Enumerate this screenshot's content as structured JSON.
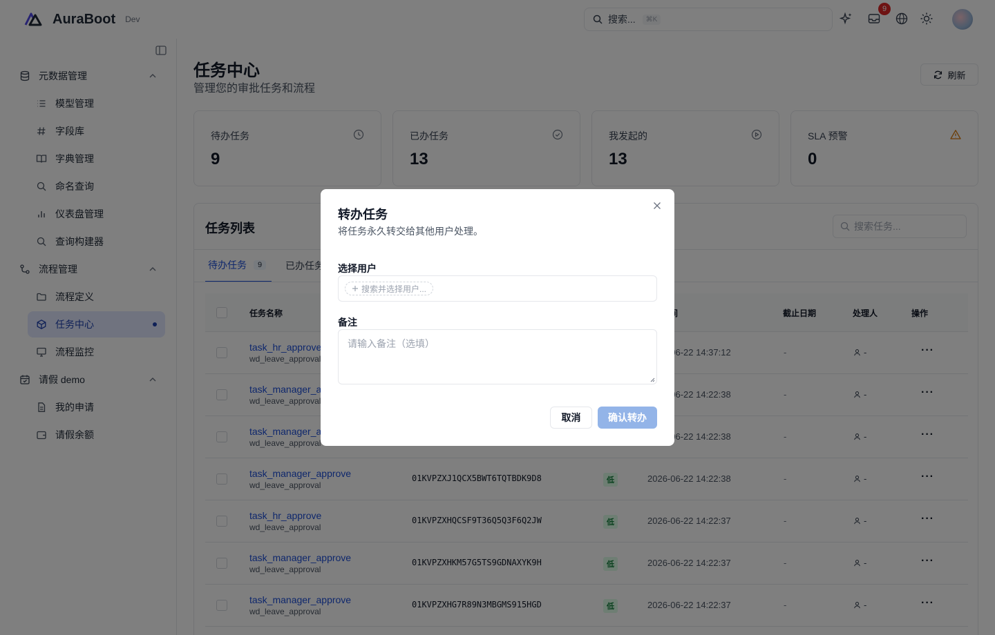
{
  "header": {
    "brand": "AuraBoot",
    "env": "Dev",
    "search_placeholder": "搜索...",
    "search_shortcut": "⌘K",
    "notification_count": "9"
  },
  "sidebar": {
    "groups": [
      {
        "label": "元数据管理",
        "items": [
          {
            "label": "模型管理"
          },
          {
            "label": "字段库"
          },
          {
            "label": "字典管理"
          },
          {
            "label": "命名查询"
          },
          {
            "label": "仪表盘管理"
          },
          {
            "label": "查询构建器"
          }
        ]
      },
      {
        "label": "流程管理",
        "items": [
          {
            "label": "流程定义"
          },
          {
            "label": "任务中心"
          },
          {
            "label": "流程监控"
          }
        ]
      },
      {
        "label": "请假 demo",
        "items": [
          {
            "label": "我的申请"
          },
          {
            "label": "请假余额"
          }
        ]
      }
    ]
  },
  "page": {
    "title": "任务中心",
    "subtitle": "管理您的审批任务和流程",
    "refresh_label": "刷新"
  },
  "stats": [
    {
      "label": "待办任务",
      "value": "9"
    },
    {
      "label": "已办任务",
      "value": "13"
    },
    {
      "label": "我发起的",
      "value": "13"
    },
    {
      "label": "SLA 预警",
      "value": "0"
    }
  ],
  "task_list": {
    "title": "任务列表",
    "search_placeholder": "搜索任务...",
    "tabs": [
      {
        "label": "待办任务",
        "count": "9"
      },
      {
        "label": "已办任务"
      }
    ],
    "columns": {
      "name": "任务名称",
      "time_suffix": "间",
      "due": "截止日期",
      "assignee": "处理人",
      "actions": "操作"
    },
    "rows": [
      {
        "name": "task_hr_approve",
        "sub": "wd_leave_approval",
        "id": "",
        "priority": "",
        "time": "2026-06-22 14:37:12",
        "due": "-",
        "assignee": "-"
      },
      {
        "name": "task_manager_approve",
        "sub": "wd_leave_approval",
        "id": "",
        "priority": "",
        "time": "2026-06-22 14:22:38",
        "due": "-",
        "assignee": "-"
      },
      {
        "name": "task_manager_approve",
        "sub": "wd_leave_approval",
        "id": "",
        "priority": "",
        "time": "2026-06-22 14:22:38",
        "due": "-",
        "assignee": "-"
      },
      {
        "name": "task_manager_approve",
        "sub": "wd_leave_approval",
        "id": "01KVPZXJ1QCX5BWT6TQTBDK9D8",
        "priority": "低",
        "time": "2026-06-22 14:22:38",
        "due": "-",
        "assignee": "-"
      },
      {
        "name": "task_hr_approve",
        "sub": "wd_leave_approval",
        "id": "01KVPZXHQCSF9T36Q5Q3F6Q2JW",
        "priority": "低",
        "time": "2026-06-22 14:22:37",
        "due": "-",
        "assignee": "-"
      },
      {
        "name": "task_manager_approve",
        "sub": "wd_leave_approval",
        "id": "01KVPZXHKM57G5TS9GDNAXYK9H",
        "priority": "低",
        "time": "2026-06-22 14:22:37",
        "due": "-",
        "assignee": "-"
      },
      {
        "name": "task_manager_approve",
        "sub": "wd_leave_approval",
        "id": "01KVPZXHG7R89N3MBGMS915HGD",
        "priority": "低",
        "time": "2026-06-22 14:22:37",
        "due": "-",
        "assignee": "-"
      }
    ]
  },
  "modal": {
    "title": "转办任务",
    "description": "将任务永久转交给其他用户处理。",
    "user_label": "选择用户",
    "user_placeholder": "搜索并选择用户...",
    "note_label": "备注",
    "note_placeholder": "请输入备注（选填）",
    "cancel_label": "取消",
    "confirm_label": "确认转办"
  },
  "colors": {
    "accent": "#1d4ed8",
    "active_bg": "#e0e7ff",
    "priority_low": "#15803d",
    "warning": "#d97706",
    "badge": "#dc2626",
    "confirm_disabled": "#93b4e8"
  }
}
